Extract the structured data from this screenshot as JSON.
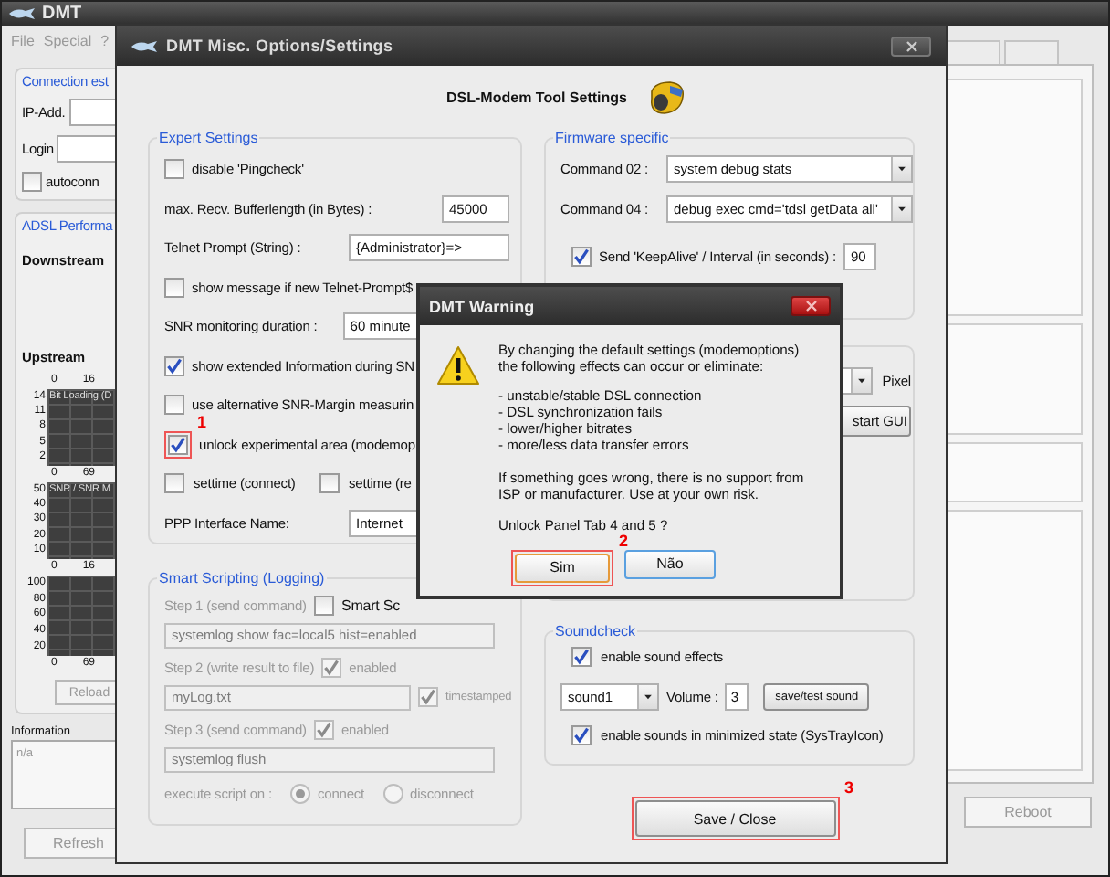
{
  "main_window": {
    "title": "DMT",
    "menu": [
      "File",
      "Special",
      "?"
    ],
    "connection": {
      "title": "Connection est",
      "fields": [
        {
          "label": "IP-Add."
        },
        {
          "label": "Login"
        }
      ],
      "autoconnect": {
        "label": "autoconn",
        "checked": false
      }
    },
    "performance": {
      "title": "ADSL Performa",
      "downstream_label": "Downstream",
      "upstream_label": "Upstream",
      "top_axis": [
        "0",
        "16"
      ],
      "graphs": [
        {
          "caption": "Bit Loading (D",
          "y_labels": [
            "14",
            "11",
            "8",
            "5",
            "2"
          ],
          "bottom_axis": [
            "0",
            "69"
          ]
        },
        {
          "caption": "SNR / SNR M",
          "y_labels": [
            "50",
            "40",
            "30",
            "20",
            "10"
          ],
          "bottom_axis": [
            "0",
            "16"
          ]
        },
        {
          "y_labels": [
            "100",
            "80",
            "60",
            "40",
            "20"
          ],
          "bottom_axis": [
            "0",
            "69"
          ]
        }
      ],
      "reload_button": "Reload"
    },
    "information": {
      "label": "Information",
      "text": "n/a"
    },
    "buttons": [
      {
        "label": "Refresh"
      },
      {
        "label": "Reboot"
      }
    ]
  },
  "options_dialog": {
    "title": "DMT Misc. Options/Settings",
    "heading": "DSL-Modem Tool Settings",
    "expert": {
      "title": "Expert Settings",
      "rows": [
        {
          "kind": "check",
          "label": "disable 'Pingcheck'",
          "checked": false
        },
        {
          "kind": "number",
          "label": "max. Recv. Bufferlength  (in Bytes) :",
          "value": "45000"
        },
        {
          "kind": "text",
          "label": "Telnet Prompt (String) :",
          "value": "{Administrator}=>"
        },
        {
          "kind": "check",
          "label": "show message if new Telnet-Prompt$",
          "checked": false
        },
        {
          "kind": "select",
          "label": "SNR monitoring duration :",
          "value": "60 minute"
        },
        {
          "kind": "check",
          "label": "show extended Information during SN",
          "checked": true
        },
        {
          "kind": "check",
          "label": "use alternative SNR-Margin measurin",
          "checked": false
        },
        {
          "kind": "check",
          "label": "unlock experimental area (modemop",
          "checked": true,
          "marker": "1"
        },
        {
          "kind": "check_pair",
          "items": [
            {
              "label": "settime (connect)",
              "checked": false
            },
            {
              "label": "settime (re",
              "checked": false
            }
          ]
        },
        {
          "kind": "text",
          "label": "PPP Interface Name:",
          "value": "Internet"
        }
      ]
    },
    "scripting": {
      "title": "Smart Scripting (Logging)",
      "disabled": true,
      "enable": {
        "label": "Smart Sc",
        "checked": false
      },
      "steps": [
        {
          "label": "Step 1 (send command)",
          "value": "systemlog show fac=local5 hist=enabled"
        },
        {
          "label": "Step 2 (write result to file)",
          "enabled": {
            "label": "enabled",
            "checked": true
          },
          "value": "myLog.txt",
          "timestamp": {
            "label": "timestamped",
            "checked": true
          }
        },
        {
          "label": "Step 3 (send command)",
          "enabled": {
            "label": "enabled",
            "checked": true
          },
          "value": "systemlog flush"
        }
      ],
      "execute_label": "execute script on :",
      "options": [
        {
          "label": "connect",
          "selected": true
        },
        {
          "label": "disconnect",
          "selected": false
        }
      ]
    },
    "firmware": {
      "title": "Firmware specific",
      "commands": [
        {
          "label": "Command 02 :",
          "value": "system debug stats"
        },
        {
          "label": "Command 04 :",
          "value": "debug exec cmd='tdsl getData all'"
        }
      ],
      "keepalive": {
        "label": "Send 'KeepAlive' / Interval (in seconds) :",
        "checked": true,
        "value": "90"
      }
    },
    "display": {
      "unit": "Pixel",
      "button": "start GUI"
    },
    "sound": {
      "title": "Soundcheck",
      "enable": {
        "label": "enable sound effects",
        "checked": true
      },
      "sound": "sound1",
      "volume_label": "Volume :",
      "volume": "3",
      "test_button": "save/test sound",
      "minimized": {
        "label": "enable sounds in minimized state (SysTrayIcon)",
        "checked": true
      }
    },
    "save_button": {
      "label": "Save / Close",
      "marker": "3"
    }
  },
  "warning": {
    "title": "DMT Warning",
    "intro": "By changing the default settings (modemoptions) the following effects can occur or eliminate:",
    "effects": [
      "- unstable/stable DSL connection",
      "- DSL synchronization fails",
      "- lower/higher bitrates",
      "- more/less data transfer errors"
    ],
    "note": "If something goes wrong, there is no support from ISP or manufacturer. Use at your own risk.",
    "question": "Unlock Panel Tab 4 and 5 ?",
    "buttons": [
      {
        "label": "Sim",
        "selected": true,
        "marker": "2"
      },
      {
        "label": "Não",
        "selected": false
      }
    ]
  }
}
